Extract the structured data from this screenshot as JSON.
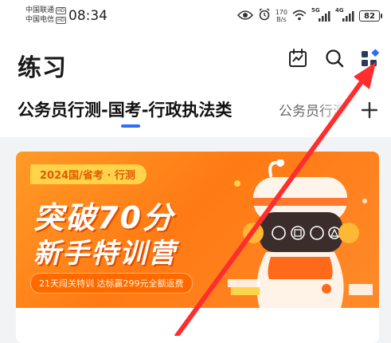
{
  "status_bar": {
    "carrier1": "中国联通",
    "carrier2": "中国电信",
    "hd_badge": "HD",
    "time": "08:34",
    "net_speed_value": "170",
    "net_speed_unit": "B/s",
    "sim1_tag": "5G",
    "sim2_tag": "4G",
    "battery": "82",
    "icons": [
      "eye-comfort-icon",
      "alarm-icon",
      "wifi-icon",
      "signal-icon",
      "battery-icon"
    ]
  },
  "header": {
    "title": "练习",
    "icons": [
      "calendar-chart-icon",
      "search-icon",
      "grid-apps-icon"
    ]
  },
  "tabs": {
    "active": "公务员行测-国考-行政执法类",
    "next": "公务员行测",
    "add_icon": "plus-icon"
  },
  "banner": {
    "tag": "2024国/省考 · 行测",
    "headline_line1": "突破70分",
    "headline_line2": "新手特训营",
    "subtag": "21天闯关特训 达标赢299元全额返费"
  },
  "colors": {
    "accent": "#2f6df6",
    "banner_orange": "#ff7a14",
    "annotation_red": "#ff2d2d"
  }
}
